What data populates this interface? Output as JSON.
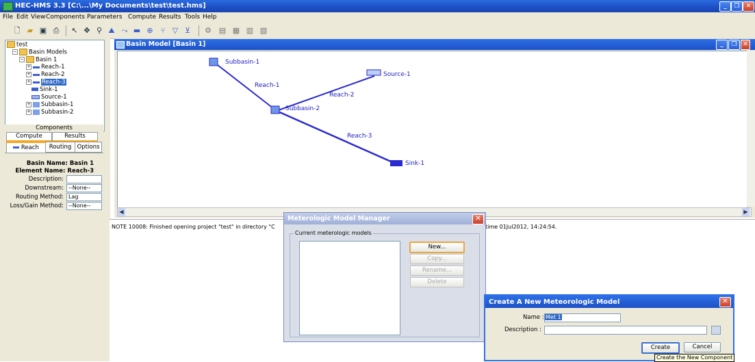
{
  "window": {
    "title": "HEC-HMS 3.3 [C:\\...\\My Documents\\test\\test.hms]"
  },
  "menu": [
    "File",
    "Edit",
    "View",
    "Components",
    "Parameters",
    "Compute",
    "Results",
    "Tools",
    "Help"
  ],
  "tree": {
    "root": "test",
    "basin_models": "Basin Models",
    "basin": "Basin 1",
    "items": [
      "Reach-1",
      "Reach-2",
      "Reach-3",
      "Sink-1",
      "Source-1",
      "Subbasin-1",
      "Subbasin-2"
    ],
    "selected": "Reach-3"
  },
  "left_tabs": {
    "components": "Components",
    "compute": "Compute",
    "results": "Results"
  },
  "editor": {
    "tabs": [
      "Reach",
      "Routing",
      "Options"
    ],
    "basin_name": "Basin Name: Basin 1",
    "element_name": "Element Name: Reach-3",
    "description_label": "Description:",
    "description_value": "",
    "downstream_label": "Downstream:",
    "downstream_value": "--None--",
    "routing_label": "Routing Method:",
    "routing_value": "Lag",
    "lossgain_label": "Loss/Gain Method:",
    "lossgain_value": "--None--"
  },
  "basin_window": {
    "title": "Basin Model [Basin 1]",
    "elements": {
      "subbasin1": "Subbasin-1",
      "subbasin2": "Subbasin-2",
      "source1": "Source-1",
      "sink1": "Sink-1",
      "reach1": "Reach-1",
      "reach2": "Reach-2",
      "reach3": "Reach-3"
    }
  },
  "log": {
    "left": "NOTE 10008:  Finished opening project \"test\" in directory \"C",
    "right": "time 01Jul2012, 14:24:54."
  },
  "met_manager": {
    "title": "Meterologic Model Manager",
    "group_label": "Current meterologic models",
    "buttons": {
      "new": "New...",
      "copy": "Copy...",
      "rename": "Rename...",
      "delete": "Delete"
    }
  },
  "new_dialog": {
    "title": "Create A New Meteorologic Model",
    "name_label": "Name :",
    "name_value": "Met 1",
    "description_label": "Description :",
    "description_value": "",
    "create": "Create",
    "cancel": "Cancel",
    "tooltip": "Create the New Component"
  },
  "colors": {
    "titlebar": "#1c4fc4",
    "element_text": "#2020c0",
    "link": "#2a2ad0"
  }
}
